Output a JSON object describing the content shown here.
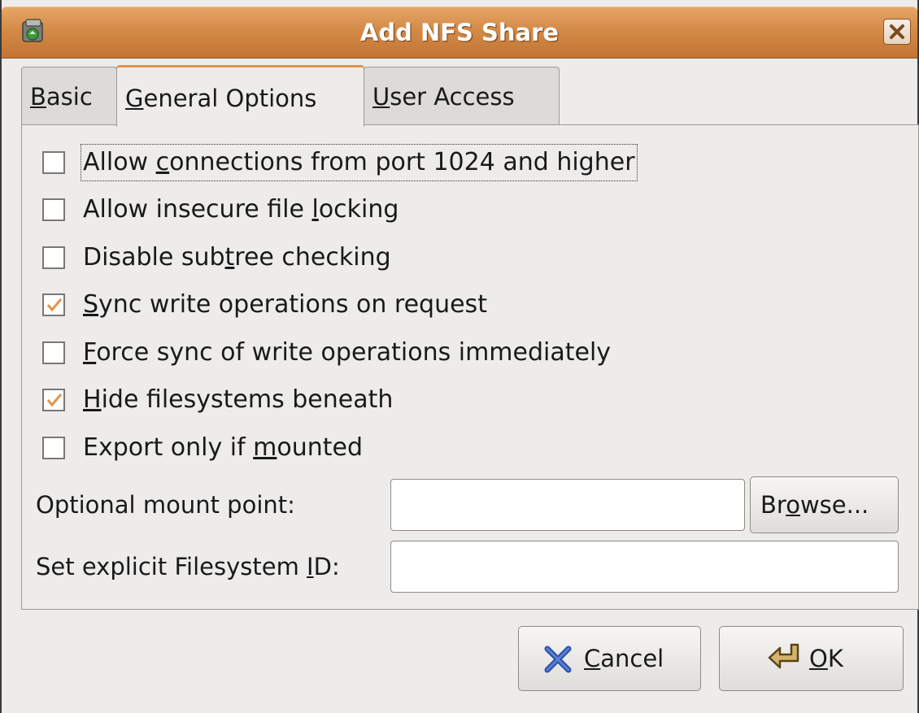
{
  "window": {
    "title": "Add NFS Share"
  },
  "tabs": [
    {
      "label_u": "B",
      "label_rest": "asic",
      "active": false
    },
    {
      "label_u": "G",
      "label_rest": "eneral Options",
      "active": true
    },
    {
      "label_u": "U",
      "label_rest": "ser Access",
      "active": false
    }
  ],
  "options": [
    {
      "pre": "Allow ",
      "u": "c",
      "post": "onnections from port 1024 and higher",
      "checked": false
    },
    {
      "pre": "Allow insecure file ",
      "u": "l",
      "post": "ocking",
      "checked": false
    },
    {
      "pre": "Disable sub",
      "u": "t",
      "post": "ree checking",
      "checked": false
    },
    {
      "pre": "",
      "u": "S",
      "post": "ync write operations on request",
      "checked": true
    },
    {
      "pre": "",
      "u": "F",
      "post": "orce sync of write operations immediately",
      "checked": false
    },
    {
      "pre": "",
      "u": "H",
      "post": "ide filesystems beneath",
      "checked": true
    },
    {
      "pre": "Export only if ",
      "u": "m",
      "post": "ounted",
      "checked": false
    }
  ],
  "mount_point": {
    "label": "Optional mount point:",
    "value": ""
  },
  "browse": {
    "pre": "Br",
    "u": "o",
    "post": "wse..."
  },
  "fsid": {
    "label_pre": "Set explicit Filesystem ",
    "label_u": "I",
    "label_post": "D:",
    "value": ""
  },
  "buttons": {
    "cancel": {
      "u": "C",
      "rest": "ancel"
    },
    "ok": {
      "u": "O",
      "rest": "K"
    }
  },
  "colors": {
    "titlebar": "#d48a47",
    "check_accent": "#e0954d"
  }
}
